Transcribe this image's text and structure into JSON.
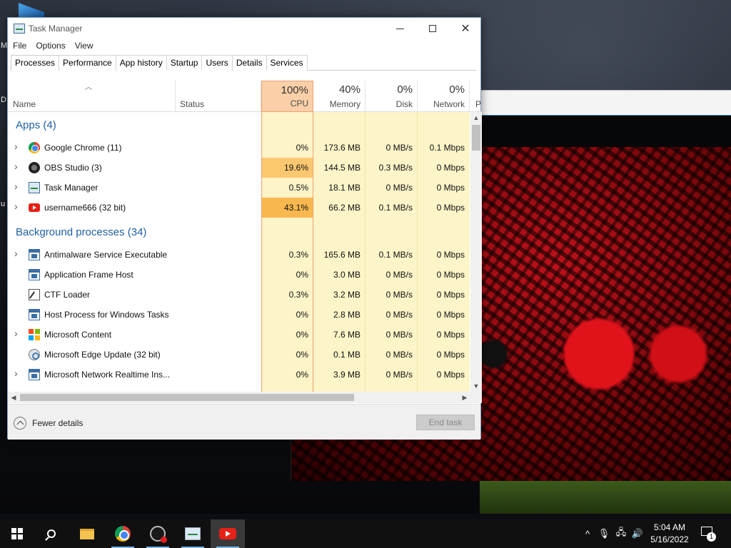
{
  "desktop": {
    "edge_letters": [
      "M",
      "D",
      "u"
    ]
  },
  "window": {
    "title": "Task Manager",
    "close_glyph": "✕"
  },
  "menu": [
    "File",
    "Options",
    "View"
  ],
  "tabs": [
    "Processes",
    "Performance",
    "App history",
    "Startup",
    "Users",
    "Details",
    "Services"
  ],
  "active_tab": "Processes",
  "columns": {
    "name": "Name",
    "status": "Status",
    "cpu": {
      "pct": "100%",
      "label": "CPU"
    },
    "memory": {
      "pct": "40%",
      "label": "Memory"
    },
    "disk": {
      "pct": "0%",
      "label": "Disk"
    },
    "network": {
      "pct": "0%",
      "label": "Network"
    },
    "power": "P"
  },
  "groups": {
    "apps": "Apps (4)",
    "background": "Background processes (34)"
  },
  "apps": [
    {
      "name": "Google Chrome (11)",
      "icon": "chrome-icon",
      "expandable": true,
      "cpu": "0%",
      "memory": "173.6 MB",
      "disk": "0 MB/s",
      "network": "0.1 Mbps",
      "cpu_heat": 0
    },
    {
      "name": "OBS Studio (3)",
      "icon": "obs-icon",
      "expandable": true,
      "cpu": "19.6%",
      "memory": "144.5 MB",
      "disk": "0.3 MB/s",
      "network": "0 Mbps",
      "cpu_heat": 0.196
    },
    {
      "name": "Task Manager",
      "icon": "task-manager-icon",
      "expandable": true,
      "cpu": "0.5%",
      "memory": "18.1 MB",
      "disk": "0 MB/s",
      "network": "0 Mbps",
      "cpu_heat": 0.005
    },
    {
      "name": "username666 (32 bit)",
      "icon": "youtube-icon",
      "expandable": true,
      "cpu": "43.1%",
      "memory": "66.2 MB",
      "disk": "0.1 MB/s",
      "network": "0 Mbps",
      "cpu_heat": 0.431
    }
  ],
  "background": [
    {
      "name": "Antimalware Service Executable",
      "icon": "window-app-icon",
      "expandable": true,
      "cpu": "0.3%",
      "memory": "165.6 MB",
      "disk": "0.1 MB/s",
      "network": "0 Mbps",
      "cpu_heat": 0.003
    },
    {
      "name": "Application Frame Host",
      "icon": "window-app-icon",
      "expandable": false,
      "cpu": "0%",
      "memory": "3.0 MB",
      "disk": "0 MB/s",
      "network": "0 Mbps",
      "cpu_heat": 0
    },
    {
      "name": "CTF Loader",
      "icon": "ctf-loader-icon",
      "expandable": false,
      "cpu": "0.3%",
      "memory": "3.2 MB",
      "disk": "0 MB/s",
      "network": "0 Mbps",
      "cpu_heat": 0.003
    },
    {
      "name": "Host Process for Windows Tasks",
      "icon": "window-app-icon",
      "expandable": false,
      "cpu": "0%",
      "memory": "2.8 MB",
      "disk": "0 MB/s",
      "network": "0 Mbps",
      "cpu_heat": 0
    },
    {
      "name": "Microsoft Content",
      "icon": "microsoft-logo-icon",
      "expandable": true,
      "cpu": "0%",
      "memory": "7.6 MB",
      "disk": "0 MB/s",
      "network": "0 Mbps",
      "cpu_heat": 0
    },
    {
      "name": "Microsoft Edge Update (32 bit)",
      "icon": "edge-update-icon",
      "expandable": false,
      "cpu": "0%",
      "memory": "0.1 MB",
      "disk": "0 MB/s",
      "network": "0 Mbps",
      "cpu_heat": 0
    },
    {
      "name": "Microsoft Network Realtime Ins...",
      "icon": "window-app-icon",
      "expandable": true,
      "cpu": "0%",
      "memory": "3.9 MB",
      "disk": "0 MB/s",
      "network": "0 Mbps",
      "cpu_heat": 0
    }
  ],
  "footer": {
    "fewer_details": "Fewer details",
    "end_task": "End task"
  },
  "taskbar": {
    "pinned": [
      "start-icon",
      "search-icon",
      "file-explorer-icon",
      "chrome-icon",
      "obs-icon",
      "task-manager-icon",
      "youtube-icon"
    ],
    "active": "youtube-icon",
    "time": "5:04 AM",
    "date": "5/16/2022",
    "notification_count": "1",
    "tray_glyphs": {
      "chevron": "^",
      "mic": "🎙",
      "network": "🖧",
      "volume": "🔊"
    }
  },
  "colors": {
    "accent_blue": "#1f5fa6",
    "cpu_header": "#fbcfa7",
    "heat_cell": "#fdf4c8",
    "heat_high": "#f9b84f"
  }
}
